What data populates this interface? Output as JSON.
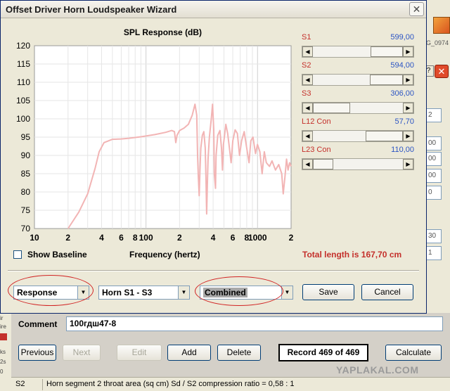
{
  "window": {
    "title": "Offset Driver Horn Loudspeaker Wizard",
    "close_glyph": "✕"
  },
  "chart_data": {
    "type": "line",
    "title": "SPL Response (dB)",
    "xlabel": "Frequency (hertz)",
    "ylabel": "",
    "xscale": "log",
    "xlim": [
      10,
      2000
    ],
    "ylim": [
      70,
      120
    ],
    "x_tick_labels": [
      "10",
      "2",
      "4",
      "6",
      "8",
      "100",
      "2",
      "4",
      "6",
      "8",
      "1000",
      "2"
    ],
    "y_tick_labels": [
      "120",
      "115",
      "110",
      "105",
      "100",
      "95",
      "90",
      "85",
      "80",
      "75",
      "70"
    ],
    "grid": true,
    "line_color": "#f2b4b4",
    "series": [
      {
        "values": [
          [
            20,
            70
          ],
          [
            25,
            74.5
          ],
          [
            30,
            79.5
          ],
          [
            35,
            86.5
          ],
          [
            38,
            91
          ],
          [
            42,
            93.5
          ],
          [
            50,
            94.4
          ],
          [
            60,
            94.5
          ],
          [
            70,
            94.7
          ],
          [
            80,
            94.9
          ],
          [
            90,
            95.1
          ],
          [
            100,
            95.3
          ],
          [
            120,
            95.7
          ],
          [
            150,
            96.3
          ],
          [
            170,
            96.8
          ],
          [
            180,
            96.5
          ],
          [
            185,
            93.5
          ],
          [
            190,
            95.5
          ],
          [
            200,
            96.8
          ],
          [
            220,
            97.5
          ],
          [
            240,
            98.5
          ],
          [
            260,
            101
          ],
          [
            275,
            104
          ],
          [
            285,
            101
          ],
          [
            290,
            90
          ],
          [
            295,
            84
          ],
          [
            300,
            79
          ],
          [
            305,
            86
          ],
          [
            310,
            92
          ],
          [
            320,
            95.5
          ],
          [
            330,
            96.5
          ],
          [
            340,
            92
          ],
          [
            345,
            84
          ],
          [
            350,
            74
          ],
          [
            355,
            82
          ],
          [
            360,
            89
          ],
          [
            370,
            95
          ],
          [
            385,
            100
          ],
          [
            395,
            104
          ],
          [
            405,
            97
          ],
          [
            410,
            85
          ],
          [
            420,
            81
          ],
          [
            425,
            90
          ],
          [
            440,
            95.5
          ],
          [
            460,
            96.8
          ],
          [
            475,
            92
          ],
          [
            485,
            86
          ],
          [
            495,
            93
          ],
          [
            520,
            98.5
          ],
          [
            540,
            96
          ],
          [
            560,
            92
          ],
          [
            580,
            88
          ],
          [
            600,
            94
          ],
          [
            630,
            97
          ],
          [
            660,
            96
          ],
          [
            690,
            90
          ],
          [
            720,
            94
          ],
          [
            760,
            96.5
          ],
          [
            800,
            92
          ],
          [
            840,
            88
          ],
          [
            870,
            94
          ],
          [
            910,
            95
          ],
          [
            960,
            90.5
          ],
          [
            1000,
            93
          ],
          [
            1050,
            91
          ],
          [
            1100,
            85
          ],
          [
            1150,
            91
          ],
          [
            1200,
            88
          ],
          [
            1280,
            87
          ],
          [
            1350,
            88.5
          ],
          [
            1450,
            86
          ],
          [
            1550,
            87.5
          ],
          [
            1650,
            85
          ],
          [
            1700,
            79.5
          ],
          [
            1760,
            84
          ],
          [
            1820,
            89
          ],
          [
            1880,
            86
          ],
          [
            1940,
            88
          ],
          [
            2000,
            87
          ]
        ]
      }
    ]
  },
  "sliders": [
    {
      "label": "S1",
      "value": "599,00",
      "fraction": 0.72
    },
    {
      "label": "S2",
      "value": "594,00",
      "fraction": 0.71
    },
    {
      "label": "S3",
      "value": "306,00",
      "fraction": 0.34
    },
    {
      "label": "L12  Con",
      "value": "57,70",
      "fraction": 0.66
    },
    {
      "label": "L23  Con",
      "value": "110,00",
      "fraction": 0.13
    }
  ],
  "show_baseline": {
    "label": "Show Baseline",
    "checked": false
  },
  "total_length": "Total length is 167,70 cm",
  "dropdowns": {
    "plot_type": "Response",
    "horn_segment": "Horn S1 - S3",
    "mode": "Combined"
  },
  "buttons": {
    "save": "Save",
    "cancel": "Cancel"
  },
  "comment": {
    "label": "Comment",
    "value": "100гдш47-8"
  },
  "nav": {
    "previous": "Previous",
    "next": "Next",
    "edit": "Edit",
    "add": "Add",
    "delete": "Delete",
    "record": "Record 469 of 469",
    "calculate": "Calculate"
  },
  "status": {
    "field_id": "S2",
    "text": "Horn segment 2 throat area  (sq cm)   Sd / S2 compression ratio = 0,58 : 1"
  },
  "watermark": "YAPLAKAL.COM",
  "background": {
    "filename": "G_0974",
    "field_values": [
      "2",
      "00",
      "00",
      "00",
      "0",
      "30",
      "1"
    ],
    "left_marks": [
      "ir",
      "ire",
      "ks",
      "2s",
      "0"
    ]
  },
  "colors": {
    "accent_red": "#c4302b",
    "value_blue": "#2c55c4"
  }
}
